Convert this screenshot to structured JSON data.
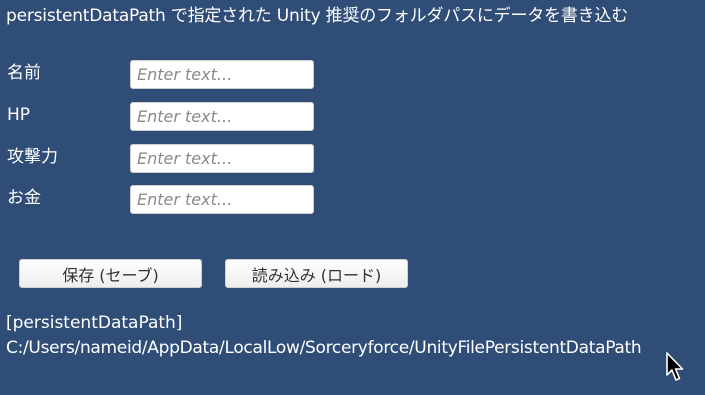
{
  "header": {
    "title": "persistentDataPath で指定された Unity 推奨のフォルダパスにデータを書き込む"
  },
  "form": {
    "fields": [
      {
        "label": "名前",
        "placeholder": "Enter text..."
      },
      {
        "label": "HP",
        "placeholder": "Enter text..."
      },
      {
        "label": "攻撃力",
        "placeholder": "Enter text..."
      },
      {
        "label": "お金",
        "placeholder": "Enter text..."
      }
    ]
  },
  "actions": {
    "save_label": "保存 (セーブ)",
    "load_label": "読み込み (ロード)"
  },
  "path_info": {
    "heading": "[persistentDataPath]",
    "value": "C:/Users/nameid/AppData/LocalLow/Sorceryforce/UnityFilePersistentDataPath"
  },
  "colors": {
    "background": "#304d77",
    "text": "#ffffff",
    "input_background": "#ffffff",
    "button_text": "#323232"
  },
  "icons": {
    "cursor": "mouse-pointer-icon"
  }
}
